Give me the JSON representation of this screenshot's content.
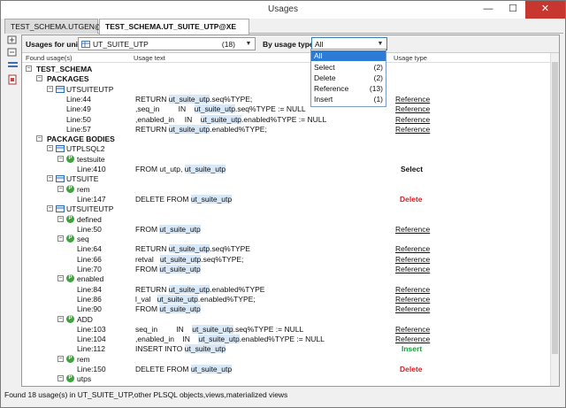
{
  "window": {
    "title": "Usages",
    "minimize": "—",
    "maximize": "☐",
    "close": "✕"
  },
  "tabs": [
    {
      "label": "TEST_SCHEMA.UTGEN@XE",
      "active": false
    },
    {
      "label": "TEST_SCHEMA.UT_SUITE_UTP@XE",
      "active": true
    }
  ],
  "filter": {
    "unit_label": "Usages for unit :",
    "unit_value": "UT_SUITE_UTP",
    "unit_count": "(18)",
    "type_label": "By usage type:",
    "type_value": "All"
  },
  "columns": {
    "found": "Found usage(s)",
    "text": "Usage text",
    "type": "Usage type"
  },
  "dropdown_options": [
    {
      "label": "All",
      "count": ""
    },
    {
      "label": "Select",
      "count": "(2)"
    },
    {
      "label": "Delete",
      "count": "(2)"
    },
    {
      "label": "Reference",
      "count": "(13)"
    },
    {
      "label": "Insert",
      "count": "(1)"
    }
  ],
  "tree": {
    "schema": "TEST_SCHEMA",
    "packages_label": "PACKAGES",
    "bodies_label": "PACKAGE BODIES",
    "packages": [
      {
        "name": "UTSUITEUTP",
        "lines": [
          {
            "line": "Line:44",
            "pre": "RETURN ",
            "hl": "ut_suite_utp",
            "post": ".seq%TYPE;",
            "type": "Reference"
          },
          {
            "line": "Line:49",
            "pre": ",seq_in         IN    ",
            "hl": "ut_suite_utp",
            "post": ".seq%TYPE := NULL",
            "type": "Reference"
          },
          {
            "line": "Line:50",
            "pre": ",enabled_in     IN    ",
            "hl": "ut_suite_utp",
            "post": ".enabled%TYPE := NULL",
            "type": "Reference"
          },
          {
            "line": "Line:57",
            "pre": "RETURN ",
            "hl": "ut_suite_utp",
            "post": ".enabled%TYPE;",
            "type": "Reference"
          }
        ]
      }
    ],
    "bodies": [
      {
        "name": "UTPLSQL2",
        "procs": [
          {
            "name": "testsuite",
            "lines": [
              {
                "line": "Line:410",
                "pre": "FROM ut_utp, ",
                "hl": "ut_suite_utp",
                "post": "",
                "type": "Select"
              }
            ]
          }
        ]
      },
      {
        "name": "UTSUITE",
        "procs": [
          {
            "name": "rem",
            "lines": [
              {
                "line": "Line:147",
                "pre": "DELETE FROM ",
                "hl": "ut_suite_utp",
                "post": "",
                "type": "Delete"
              }
            ]
          }
        ]
      },
      {
        "name": "UTSUITEUTP",
        "procs": [
          {
            "name": "defined",
            "lines": [
              {
                "line": "Line:50",
                "pre": "FROM ",
                "hl": "ut_suite_utp",
                "post": "",
                "type": "Reference"
              }
            ]
          },
          {
            "name": "seq",
            "lines": [
              {
                "line": "Line:64",
                "pre": "RETURN ",
                "hl": "ut_suite_utp",
                "post": ".seq%TYPE",
                "type": "Reference"
              },
              {
                "line": "Line:66",
                "pre": "retval   ",
                "hl": "ut_suite_utp",
                "post": ".seq%TYPE;",
                "type": "Reference"
              },
              {
                "line": "Line:70",
                "pre": "FROM ",
                "hl": "ut_suite_utp",
                "post": "",
                "type": "Reference"
              }
            ]
          },
          {
            "name": "enabled",
            "lines": [
              {
                "line": "Line:84",
                "pre": "RETURN ",
                "hl": "ut_suite_utp",
                "post": ".enabled%TYPE",
                "type": "Reference"
              },
              {
                "line": "Line:86",
                "pre": "l_val   ",
                "hl": "ut_suite_utp",
                "post": ".enabled%TYPE;",
                "type": "Reference"
              },
              {
                "line": "Line:90",
                "pre": "FROM ",
                "hl": "ut_suite_utp",
                "post": "",
                "type": "Reference"
              }
            ]
          },
          {
            "name": "ADD",
            "lines": [
              {
                "line": "Line:103",
                "pre": "seq_in         IN    ",
                "hl": "ut_suite_utp",
                "post": ".seq%TYPE := NULL",
                "type": "Reference"
              },
              {
                "line": "Line:104",
                "pre": ",enabled_in    IN    ",
                "hl": "ut_suite_utp",
                "post": ".enabled%TYPE := NULL",
                "type": "Reference"
              },
              {
                "line": "Line:112",
                "pre": "INSERT INTO ",
                "hl": "ut_suite_utp",
                "post": "",
                "type": "Insert"
              }
            ]
          },
          {
            "name": "rem",
            "lines": [
              {
                "line": "Line:150",
                "pre": "DELETE FROM ",
                "hl": "ut_suite_utp",
                "post": "",
                "type": "Delete"
              }
            ]
          },
          {
            "name": "utps",
            "lines": []
          }
        ]
      }
    ]
  },
  "status": "Found 18 usage(s) in UT_SUITE_UTP,other PLSQL objects,views,materialized views",
  "colors": {
    "accent": "#2e7bd6",
    "delete": "#e01919",
    "insert": "#19a23c",
    "highlight": "#d9e8f7"
  }
}
